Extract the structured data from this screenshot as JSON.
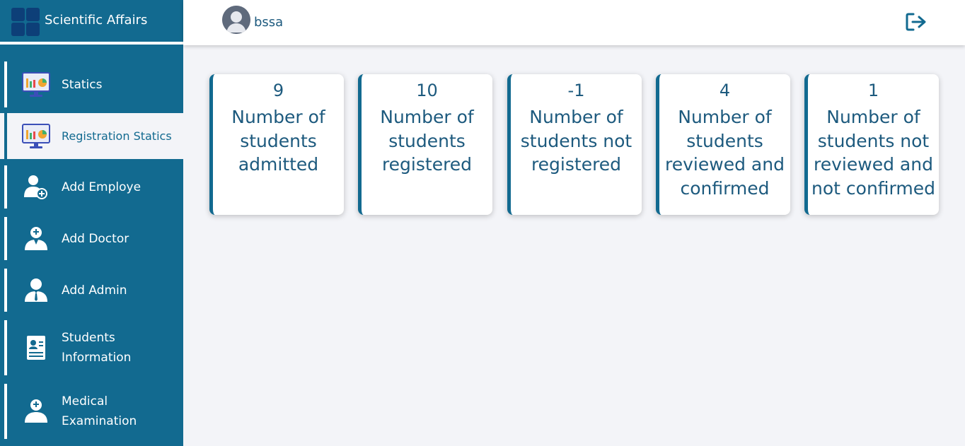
{
  "app": {
    "title": "Scientific Affairs"
  },
  "user": {
    "name": "bssa"
  },
  "sidebar": {
    "items": [
      {
        "label": "Statics",
        "icon": "chart-monitor-icon",
        "active": false
      },
      {
        "label": "Registration Statics",
        "icon": "chart-monitor-icon",
        "active": true
      },
      {
        "label": "Add Employe",
        "icon": "add-user-icon",
        "active": false
      },
      {
        "label": "Add Doctor",
        "icon": "doctor-icon",
        "active": false
      },
      {
        "label": "Add Admin",
        "icon": "admin-user-icon",
        "active": false
      },
      {
        "label": "Students Information",
        "icon": "id-card-icon",
        "active": false
      },
      {
        "label": "Medical Examination",
        "icon": "medical-user-icon",
        "active": false
      }
    ]
  },
  "cards": [
    {
      "value": "9",
      "label": "Number of students admitted"
    },
    {
      "value": "10",
      "label": "Number of students registered"
    },
    {
      "value": "-1",
      "label": "Number of students not registered"
    },
    {
      "value": "4",
      "label": "Number of students reviewed and confirmed"
    },
    {
      "value": "1",
      "label": "Number of students not reviewed and not confirmed"
    }
  ],
  "colors": {
    "primary": "#126a90",
    "text": "#1d5a7e",
    "background": "#f3f4f8",
    "logo": "#0d3f78"
  }
}
